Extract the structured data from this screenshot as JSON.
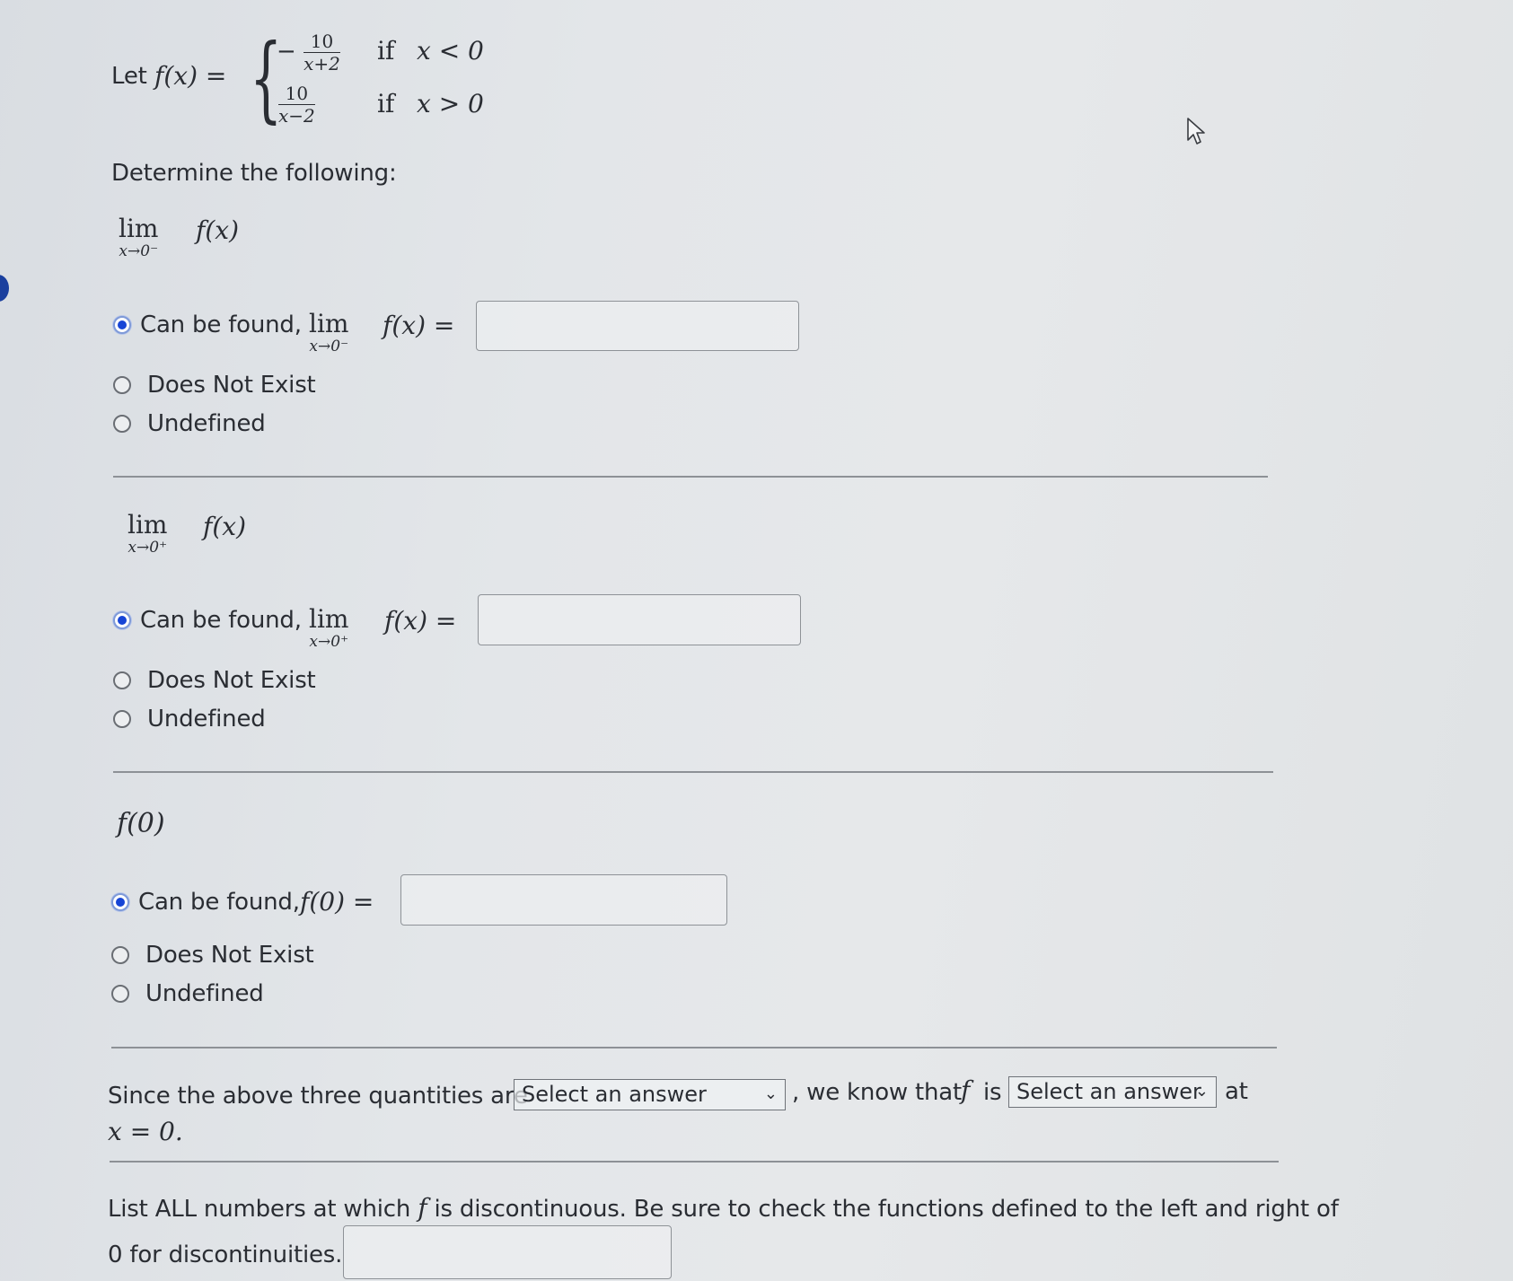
{
  "problem": {
    "let_label": "Let",
    "function_name": "f(x) =",
    "cases": [
      {
        "sign": "−",
        "numerator": "10",
        "denominator": "x+2",
        "condition_if": "if",
        "condition": "x < 0"
      },
      {
        "sign": "",
        "numerator": "10",
        "denominator": "x−2",
        "condition_if": "if",
        "condition": "x > 0"
      }
    ],
    "instruction": "Determine the following:"
  },
  "parts": [
    {
      "heading_lim": "lim",
      "heading_sub": "x→0⁻",
      "heading_expr": "f(x)",
      "options": [
        {
          "label": "Can be found,",
          "selected": true,
          "lim": "lim",
          "lim_sub": "x→0⁻",
          "expr": "f(x) =",
          "input_value": ""
        },
        {
          "label": "Does Not Exist",
          "selected": false
        },
        {
          "label": "Undefined",
          "selected": false
        }
      ]
    },
    {
      "heading_lim": "lim",
      "heading_sub": "x→0⁺",
      "heading_expr": "f(x)",
      "options": [
        {
          "label": "Can be found,",
          "selected": true,
          "lim": "lim",
          "lim_sub": "x→0⁺",
          "expr": "f(x) =",
          "input_value": ""
        },
        {
          "label": "Does Not Exist",
          "selected": false
        },
        {
          "label": "Undefined",
          "selected": false
        }
      ]
    },
    {
      "heading_expr": "f(0)",
      "options": [
        {
          "label": "Can be found,",
          "selected": true,
          "expr": "f(0) =",
          "input_value": ""
        },
        {
          "label": "Does Not Exist",
          "selected": false
        },
        {
          "label": "Undefined",
          "selected": false
        }
      ]
    }
  ],
  "conclusion": {
    "text_before": "Since the above three quantities are",
    "select1_value": "Select an answer",
    "text_middle": ", we know that",
    "f_symbol": "f",
    "text_is": "is",
    "select2_value": "Select an answer",
    "text_at": "at",
    "text_end": "x = 0."
  },
  "discontinuities": {
    "line1_before": "List ALL numbers at which",
    "f_symbol": "f",
    "line1_after": "is discontinuous. Be sure to check the functions defined to the left and right of",
    "line2": "0 for discontinuities.",
    "input_value": ""
  },
  "colors": {
    "radio_selected": "#1745d6",
    "text": "#2a2d33"
  }
}
